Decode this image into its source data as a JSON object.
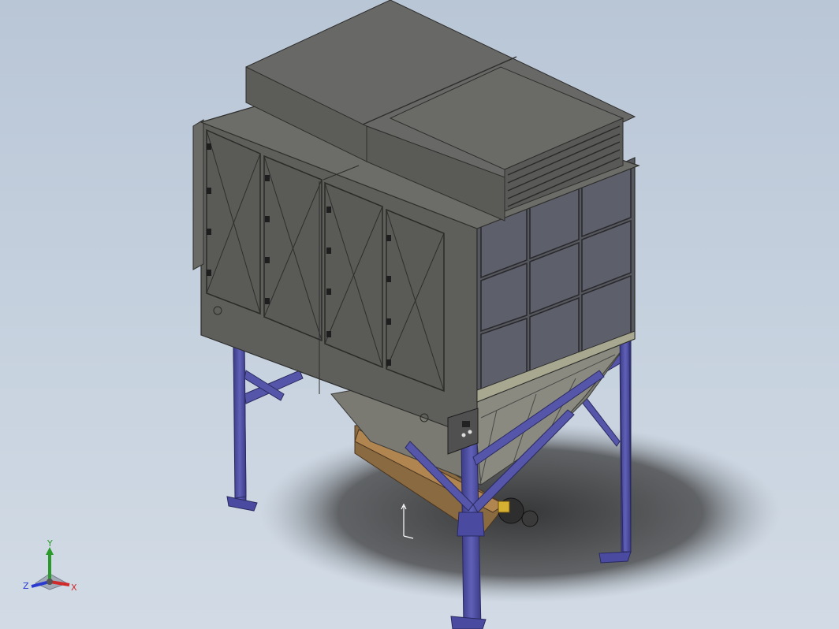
{
  "viewport": {
    "background": "#c3cedb",
    "model_colors": {
      "panel": "#5f5f5c",
      "panel_dark": "#4e4e4b",
      "panel_light": "#6b6b68",
      "frame": "#5a5ab0",
      "frame_dark": "#3e3e86",
      "glass": "#5d5f6a",
      "shadow": "#3c3c3c"
    }
  },
  "triad": {
    "x_label": "X",
    "y_label": "Y",
    "z_label": "Z",
    "x_color": "#d02a2a",
    "y_color": "#2a9a2a",
    "z_color": "#2a3ad0"
  }
}
